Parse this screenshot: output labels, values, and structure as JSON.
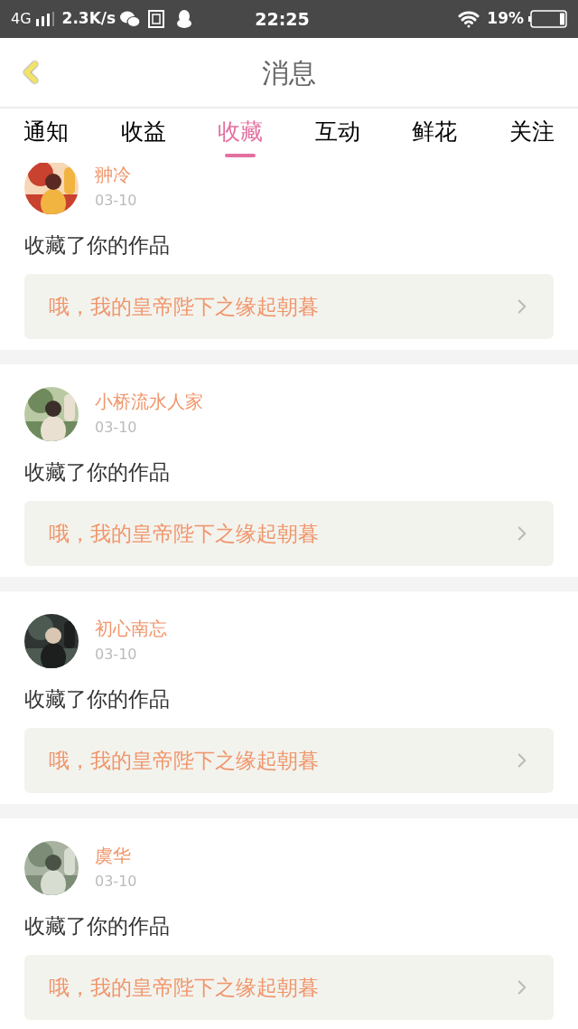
{
  "status_bar": {
    "network": "4G",
    "speed": "2.3K/s",
    "time": "22:25",
    "battery": "19%"
  },
  "header": {
    "title": "消息"
  },
  "tabs": [
    {
      "label": "通知",
      "selected": false
    },
    {
      "label": "收益",
      "selected": false
    },
    {
      "label": "收藏",
      "selected": true
    },
    {
      "label": "互动",
      "selected": false
    },
    {
      "label": "鲜花",
      "selected": false
    },
    {
      "label": "关注",
      "selected": false
    }
  ],
  "messages": [
    {
      "user": "翀冷",
      "date": "03-10",
      "text": "收藏了你的作品",
      "work": "哦，我的皇帝陛下之缘起朝暮"
    },
    {
      "user": "小桥流水人家",
      "date": "03-10",
      "text": "收藏了你的作品",
      "work": "哦，我的皇帝陛下之缘起朝暮"
    },
    {
      "user": "初心南忘",
      "date": "03-10",
      "text": "收藏了你的作品",
      "work": "哦，我的皇帝陛下之缘起朝暮"
    },
    {
      "user": "虞华",
      "date": "03-10",
      "text": "收藏了你的作品",
      "work": "哦，我的皇帝陛下之缘起朝暮"
    }
  ]
}
